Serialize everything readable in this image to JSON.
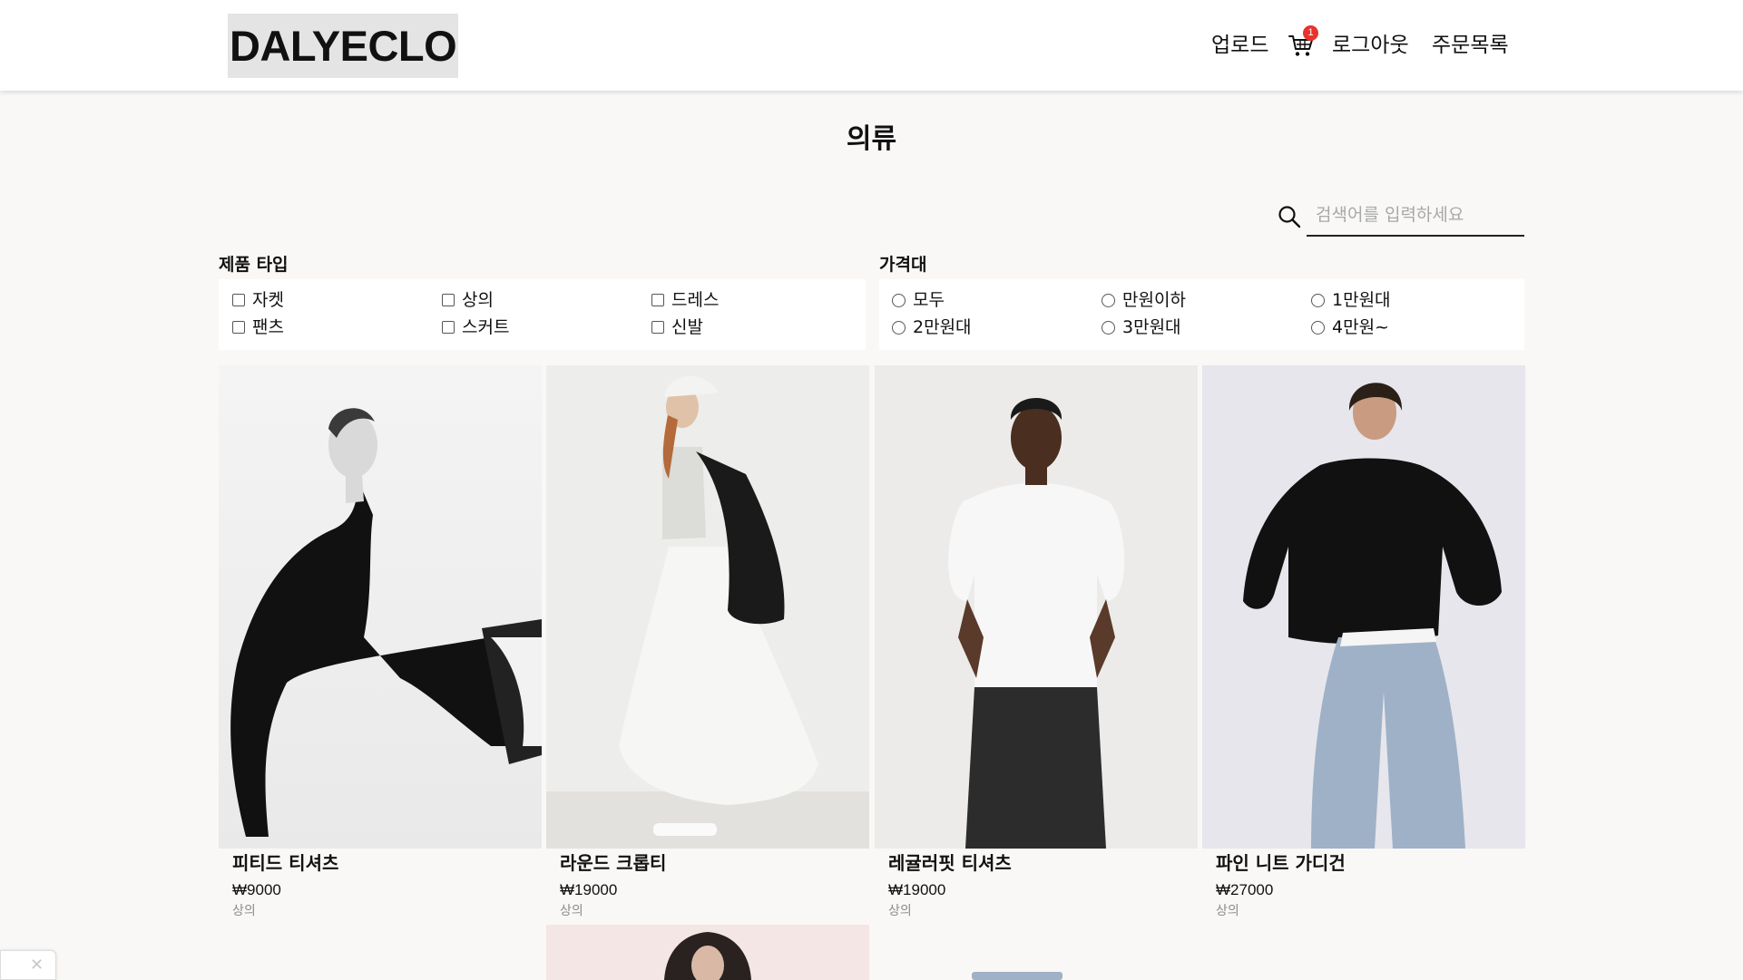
{
  "header": {
    "logo": "DALYECLO",
    "nav": {
      "upload": "업로드",
      "logout": "로그아웃",
      "orders": "주문목록"
    },
    "cart": {
      "icon": "cart-icon",
      "badge": "1"
    }
  },
  "page_title": "의류",
  "search": {
    "placeholder": "검색어를 입력하세요",
    "value": "",
    "icon": "search-icon"
  },
  "filters": {
    "type": {
      "title": "제품 타입",
      "options": [
        "자켓",
        "상의",
        "드레스",
        "팬츠",
        "스커트",
        "신발"
      ]
    },
    "price": {
      "title": "가격대",
      "options": [
        "모두",
        "만원이하",
        "1만원대",
        "2만원대",
        "3만원대",
        "4만원~"
      ]
    }
  },
  "products": [
    {
      "name": "피티드 티셔츠",
      "price": "₩9000",
      "category": "상의"
    },
    {
      "name": "라운드 크롭티",
      "price": "₩19000",
      "category": "상의"
    },
    {
      "name": "레귤러핏 티셔츠",
      "price": "₩19000",
      "category": "상의"
    },
    {
      "name": "파인 니트 가디건",
      "price": "₩27000",
      "category": "상의"
    }
  ],
  "colors": {
    "badge": "#e8322b",
    "page_bg": "#f9f8f6",
    "header_bg": "#ffffff"
  }
}
